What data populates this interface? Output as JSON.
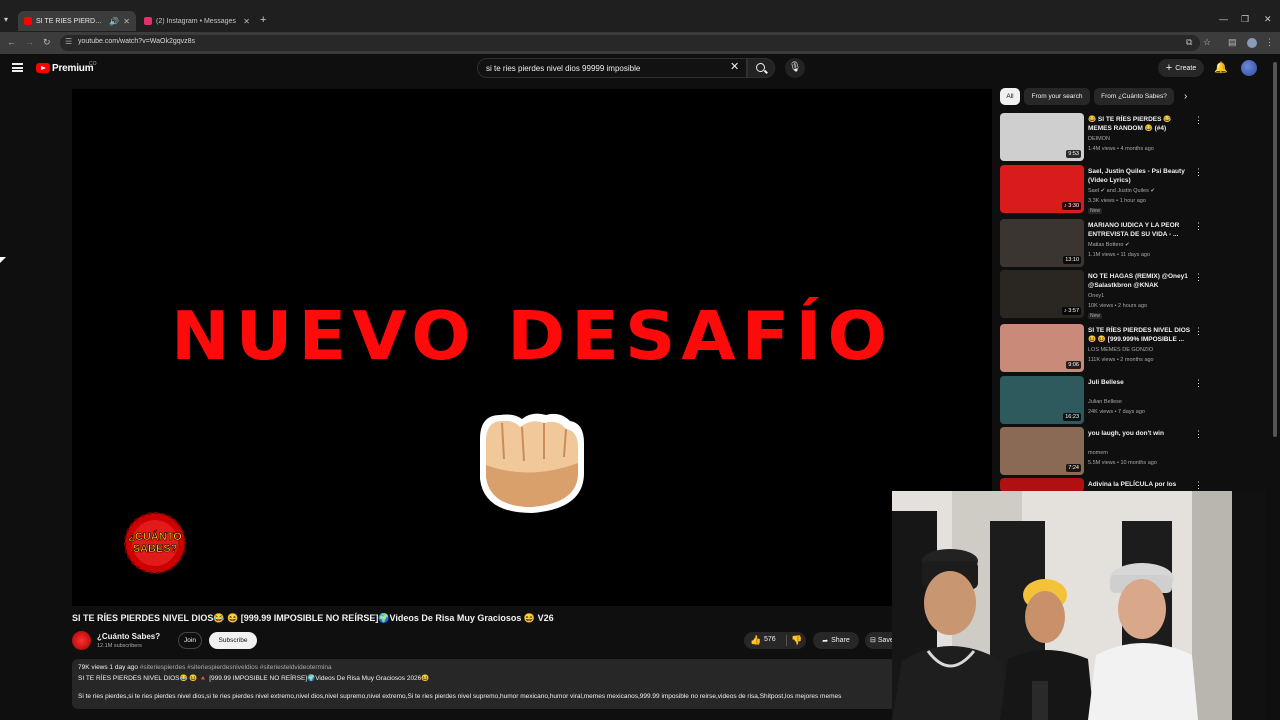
{
  "browser": {
    "tabs": [
      {
        "title": "SI TE RÍES PIERDES NIVEL D",
        "favicon_color": "#ff0000"
      },
      {
        "title": "(2) Instagram • Messages",
        "favicon_color": "#e1306c"
      }
    ],
    "url": "youtube.com/watch?v=WaOk2gqvz8s"
  },
  "header": {
    "brand": "Premium",
    "country": "CO",
    "search_query": "si te ries pierdes nivel dios 99999 imposible",
    "create_label": "Create"
  },
  "player": {
    "overlay_text": "NUEVO DESAFÍO",
    "accent_color": "#ff0a0a"
  },
  "video": {
    "title": "SI TE RÍES PIERDES NIVEL DIOS😂 😆 [999.99 IMPOSIBLE NO REÍRSE]🌍Videos De Risa Muy Graciosos 😆 V26",
    "channel": "¿Cuánto Sabes?",
    "subscribers": "12.1M subscribers",
    "join_label": "Join",
    "subscribe_label": "Subscribe",
    "likes": "576",
    "share_label": "Share",
    "save_label": "Save",
    "description": {
      "meta": "79K views  1 day ago",
      "tags": "#siteriespierdes #siteriespierdesniveldios #siteriesteldvideotermina",
      "line1": "SI TE RÍES PIERDES NIVEL DIOS😂 😆 🔺 [999.99 IMPOSIBLE NO REÍRSE]🌍Videos De Risa Muy Graciosos 2026😆",
      "line2": "Si te ries pierdes,si te ries pierdes nivel dios,si te ries pierdes nivel extremo,nivel dios,nivel supremo,nivel extremo,Si te ries pierdes nivel supremo,humor mexicano,humor viral,memes mexicanos,999.99 imposible no reirse,videos de risa,Shitpost,los mejores memes"
    }
  },
  "sidebar": {
    "chips": [
      "All",
      "From your search",
      "From ¿Cuánto Sabes?"
    ],
    "items": [
      {
        "title": "😂 SI TE RÍES PIERDES 😂 MEMES RANDOM 😂 (#4)",
        "channel": "DEIMON",
        "views": "1.4M views • 4 months ago",
        "duration": "9:53",
        "badge": "",
        "thumb": "#cfcfcf"
      },
      {
        "title": "Sael, Justin Quiles - Psi Beauty (Video Lyrics)",
        "channel": "Sael ✔ and Justin Quiles ✔",
        "views": "3.3K views • 1 hour ago",
        "duration": "♪ 3:30",
        "badge": "New",
        "thumb": "#d81b1b"
      },
      {
        "title": "MARIANO IUDICA Y LA PEOR ENTREVISTA DE SU VIDA - ...",
        "channel": "Matias Bottero ✔",
        "views": "1.1M views • 11 days ago",
        "duration": "13:10",
        "badge": "",
        "thumb": "#3a3530"
      },
      {
        "title": "NO TE HAGAS (REMIX) @Oney1 @Salastkbron @KNAK",
        "channel": "Oney1",
        "views": "10K views • 2 hours ago",
        "duration": "♪ 3:57",
        "badge": "New",
        "thumb": "#2a2622"
      },
      {
        "title": "SI TE RÍES PIERDES NIVEL DIOS 😆 😆 [999.999% IMPOSIBLE ...",
        "channel": "LOS MEMES DE GONZIO",
        "views": "111K views • 2 months ago",
        "duration": "9:06",
        "badge": "",
        "thumb": "#c98a7a"
      },
      {
        "title": "Juli Bellese",
        "channel": "Julian Bellese",
        "views": "24K views • 7 days ago",
        "duration": "16:23",
        "badge": "",
        "thumb": "#2e5a5e"
      },
      {
        "title": "you laugh, you don't win",
        "channel": "momem",
        "views": "5.5M views • 10 months ago",
        "duration": "7:24",
        "badge": "",
        "thumb": "#8a6a55"
      },
      {
        "title": "Adivina la PELÍCULA por los",
        "channel": "",
        "views": "",
        "duration": "",
        "badge": "",
        "thumb": "#b01010"
      }
    ]
  }
}
